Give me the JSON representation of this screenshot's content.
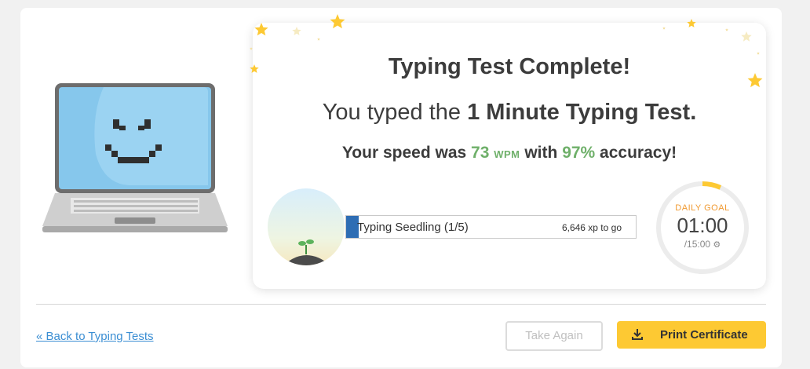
{
  "result": {
    "heading": "Typing Test Complete!",
    "typed_prefix": "You typed the ",
    "test_name": "1 Minute Typing Test.",
    "speed_prefix": "Your speed was ",
    "wpm_value": "73",
    "wpm_unit": "WPM",
    "speed_mid": " with ",
    "accuracy_value": "97%",
    "speed_suffix": " accuracy!"
  },
  "level": {
    "name": "Typing Seedling (1/5)",
    "xp_to_go": "6,646 xp to go",
    "progress_fraction": 0.04
  },
  "daily_goal": {
    "label": "DAILY GOAL",
    "time": "01:00",
    "total": "/15:00",
    "progress_fraction": 0.067
  },
  "footer": {
    "back_link": "« Back to Typing Tests",
    "take_again": "Take Again",
    "print_certificate": "Print Certificate"
  },
  "icons": {
    "settings": "gear-icon",
    "download": "download-icon",
    "mascot": "laptop-mascot-icon",
    "avatar": "seedling-icon",
    "stars": "star-icon"
  },
  "colors": {
    "accent_green": "#6fb06a",
    "goal_orange": "#f09a32",
    "print_button": "#fdc933",
    "link_blue": "#3b8ed3",
    "xp_fill": "#2e6db4"
  }
}
